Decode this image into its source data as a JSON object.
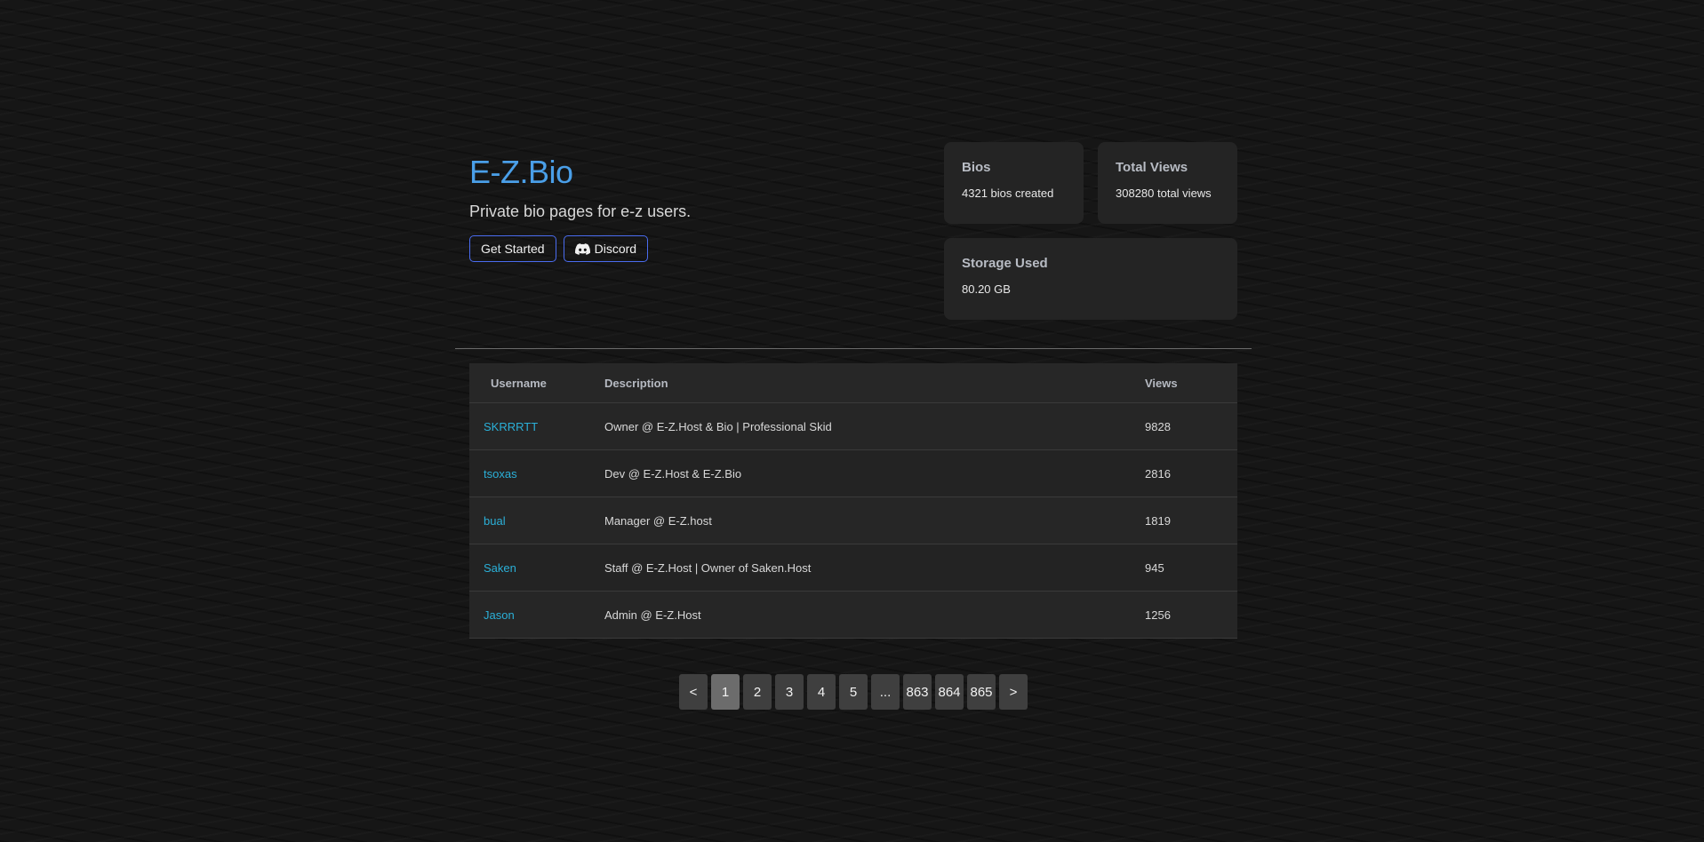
{
  "hero": {
    "title": "E-Z.Bio",
    "subtitle": "Private bio pages for e-z users.",
    "get_started_label": "Get Started",
    "discord_label": "Discord"
  },
  "stats": {
    "bios": {
      "label": "Bios",
      "value": "4321 bios created"
    },
    "views": {
      "label": "Total Views",
      "value": "308280 total views"
    },
    "storage": {
      "label": "Storage Used",
      "value": "80.20 GB"
    }
  },
  "table": {
    "headers": {
      "username": "Username",
      "description": "Description",
      "views": "Views"
    },
    "rows": [
      {
        "username": "SKRRRTT",
        "description": "Owner @ E-Z.Host & Bio | Professional Skid",
        "views": "9828"
      },
      {
        "username": "tsoxas",
        "description": "Dev @ E-Z.Host & E-Z.Bio",
        "views": "2816"
      },
      {
        "username": "bual",
        "description": "Manager @ E-Z.host",
        "views": "1819"
      },
      {
        "username": "Saken",
        "description": "Staff @ E-Z.Host | Owner of Saken.Host",
        "views": "945"
      },
      {
        "username": "Jason",
        "description": "Admin @ E-Z.Host",
        "views": "1256"
      }
    ]
  },
  "pagination": {
    "prev": "<",
    "pages": [
      "1",
      "2",
      "3",
      "4",
      "5",
      "...",
      "863",
      "864",
      "865"
    ],
    "active": "1",
    "next": ">"
  },
  "colors": {
    "accent": "#4a9fe8",
    "link": "#2bb0d8",
    "button_border": "#4a6cf0",
    "background": "#161616",
    "card": "#242424"
  }
}
